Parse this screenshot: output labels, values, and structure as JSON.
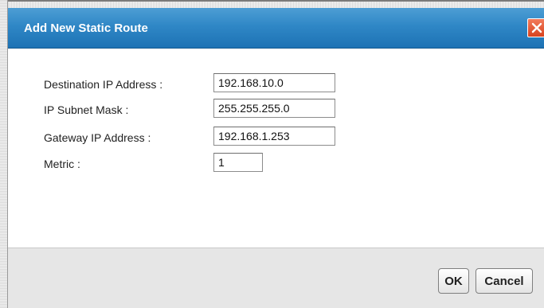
{
  "dialog": {
    "title": "Add New Static Route"
  },
  "form": {
    "destination_ip": {
      "label": "Destination IP Address :",
      "value": "192.168.10.0"
    },
    "subnet_mask": {
      "label": "IP Subnet Mask :",
      "value": "255.255.255.0"
    },
    "gateway_ip": {
      "label": "Gateway IP Address :",
      "value": "192.168.1.253"
    },
    "metric": {
      "label": "Metric :",
      "value": "1"
    }
  },
  "buttons": {
    "ok_label": "OK",
    "cancel_label": "Cancel"
  },
  "colors": {
    "titlebar": "#2f87c6",
    "close": "#e05a37",
    "footer": "#e6e6e6"
  },
  "icons": {
    "close": "close-icon"
  }
}
